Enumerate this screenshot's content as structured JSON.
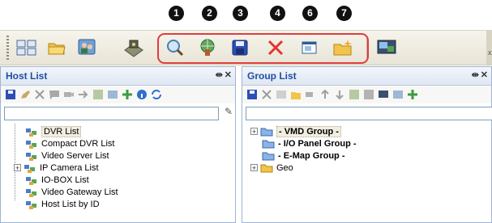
{
  "callouts": [
    "1",
    "2",
    "3",
    "4",
    "6",
    "7"
  ],
  "toolbar": {
    "buttons": [
      {
        "name": "layout-icon"
      },
      {
        "name": "open-folder-icon"
      },
      {
        "name": "users-icon"
      },
      {
        "name": "camera-device-icon"
      },
      {
        "name": "search-icon"
      },
      {
        "name": "network-tool-icon"
      },
      {
        "name": "save-icon"
      },
      {
        "name": "delete-icon"
      },
      {
        "name": "window-icon"
      },
      {
        "name": "new-folder-icon"
      },
      {
        "name": "monitor-icon"
      }
    ],
    "close_label": "x"
  },
  "host_panel": {
    "title": "Host List",
    "search_value": "",
    "items": [
      {
        "label": "DVR List",
        "selected": true,
        "expander": ""
      },
      {
        "label": "Compact DVR List",
        "selected": false,
        "expander": ""
      },
      {
        "label": "Video Server List",
        "selected": false,
        "expander": ""
      },
      {
        "label": "IP Camera List",
        "selected": false,
        "expander": "+"
      },
      {
        "label": "IO-BOX List",
        "selected": false,
        "expander": ""
      },
      {
        "label": "Video Gateway List",
        "selected": false,
        "expander": ""
      },
      {
        "label": "Host List by ID",
        "selected": false,
        "expander": ""
      }
    ]
  },
  "group_panel": {
    "title": "Group List",
    "search_value": "",
    "items": [
      {
        "label": "- VMD Group -",
        "bold": true,
        "expander": "+"
      },
      {
        "label": "- I/O Panel Group -",
        "bold": true,
        "expander": ""
      },
      {
        "label": "- E-Map Group -",
        "bold": true,
        "expander": ""
      },
      {
        "label": "Geo",
        "bold": false,
        "expander": "+"
      }
    ]
  },
  "panel_controls": {
    "pin": "⇹",
    "close": "✕"
  },
  "colors": {
    "accent_red": "#e23c3c",
    "title_blue": "#1d4fa3"
  }
}
